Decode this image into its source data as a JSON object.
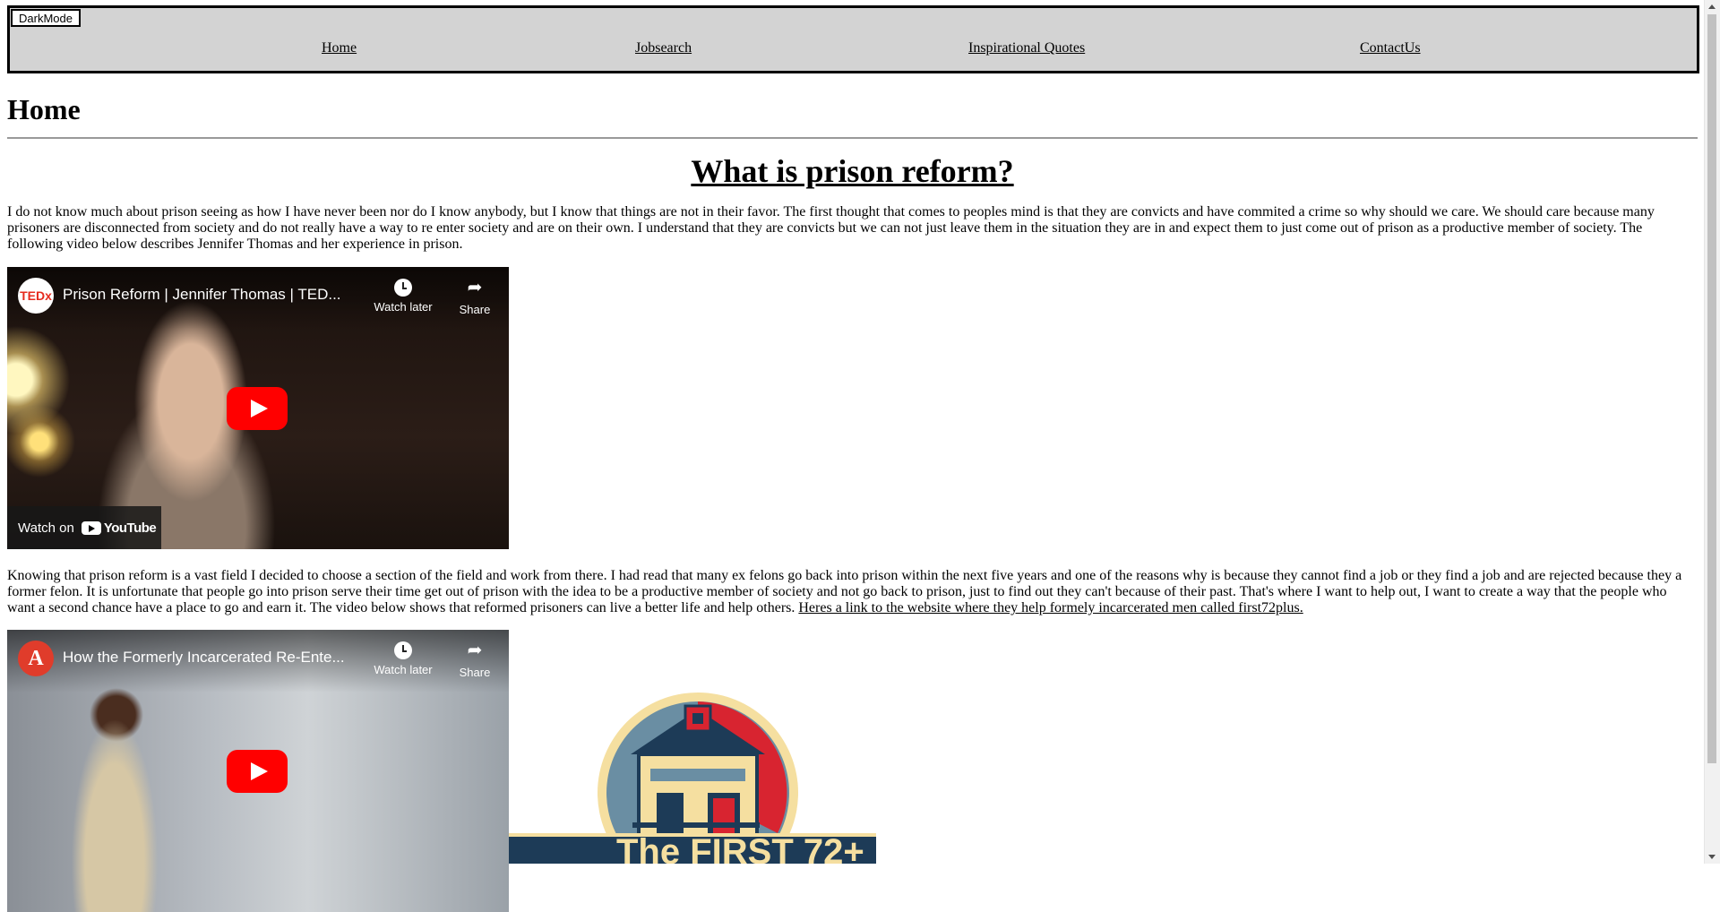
{
  "nav": {
    "darkmode_label": "DarkMode",
    "links": [
      "Home",
      "Jobsearch",
      "Inspirational Quotes",
      "ContactUs"
    ]
  },
  "page_title": "Home",
  "section_title": "What is prison reform?",
  "paragraph1": "I do not know much about prison seeing as how I have never been nor do I know anybody, but I know that things are not in their favor. The first thought that comes to peoples mind is that they are convicts and have commited a crime so why should we care. We should care because many prisoners are disconnected from society and do not really have a way to re enter society and are on their own. I understand that they are convicts but we can not just leave them in the situation they are in and expect them to just come out of prison as a productive member of society. The following video below describes Jennifer Thomas and her experience in prison.",
  "video1": {
    "channel_logo": "TEDx",
    "title": "Prison Reform | Jennifer Thomas | TED...",
    "watch_later": "Watch later",
    "share": "Share",
    "watch_on": "Watch on",
    "youtube": "YouTube"
  },
  "paragraph2": "Knowing that prison reform is a vast field I decided to choose a section of the field and work from there. I had read that many ex felons go back into prison within the next five years and one of the reasons why is because they cannot find a job or they find a job and are rejected because they a former felon. It is unfortunate that people go into prison serve their time get out of prison with the idea to be a productive member of society and not go back to prison, just to find out they can't because of their past. That's where I want to help out, I want to create a way that the people who want a second chance have a place to go and earn it. The video below shows that reformed prisoners can live a better life and help others.",
  "paragraph2_link": "Heres a link to the website where they help formely incarcerated men called first72plus.",
  "video2": {
    "channel_logo": "A",
    "title": "How the Formerly Incarcerated Re-Ente...",
    "watch_later": "Watch later",
    "share": "Share"
  },
  "logo": {
    "text": "The FIRST 72+",
    "colors": {
      "navy": "#1d3b57",
      "red": "#d82430",
      "cream": "#f5dfa0",
      "teal": "#6a8ea3"
    }
  },
  "icons": [
    "play-icon",
    "clock-icon",
    "share-icon",
    "youtube-icon",
    "house-logo"
  ]
}
